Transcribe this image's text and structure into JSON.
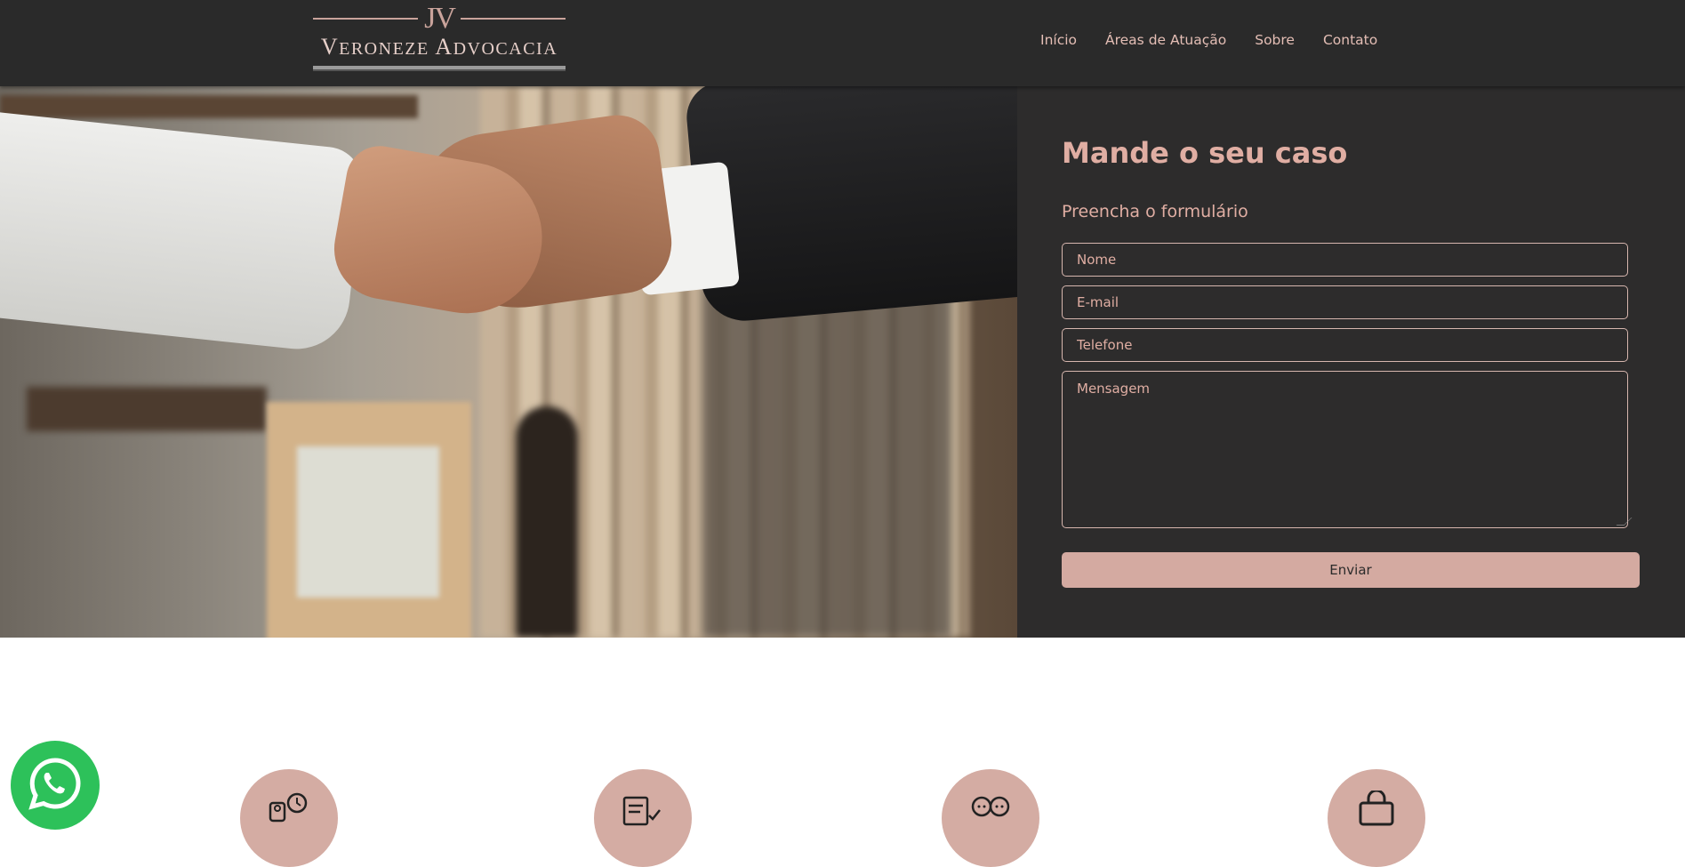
{
  "header": {
    "logo": {
      "monogram": "JV",
      "name_parts": [
        {
          "cap": "V",
          "rest": "ERONEZE"
        },
        {
          "cap": "A",
          "rest": "DVOCACIA"
        }
      ]
    },
    "nav": [
      {
        "label": "Início"
      },
      {
        "label": "Áreas de Atuação"
      },
      {
        "label": "Sobre"
      },
      {
        "label": "Contato"
      }
    ]
  },
  "form": {
    "title": "Mande o seu caso",
    "subtitle": "Preencha o formulário",
    "name_placeholder": "Nome",
    "email_placeholder": "E-mail",
    "phone_placeholder": "Telefone",
    "message_placeholder": "Mensagem",
    "submit_label": "Enviar"
  },
  "features": [
    {
      "icon": "person-clock-icon"
    },
    {
      "icon": "document-check-icon"
    },
    {
      "icon": "family-icon"
    },
    {
      "icon": "shopping-bag-icon"
    }
  ],
  "colors": {
    "header_bg": "#2a2a2a",
    "panel_bg": "#2d2c2c",
    "accent": "#e0aea3",
    "button_bg": "#d4aaa1",
    "whatsapp": "#2dc15a"
  }
}
